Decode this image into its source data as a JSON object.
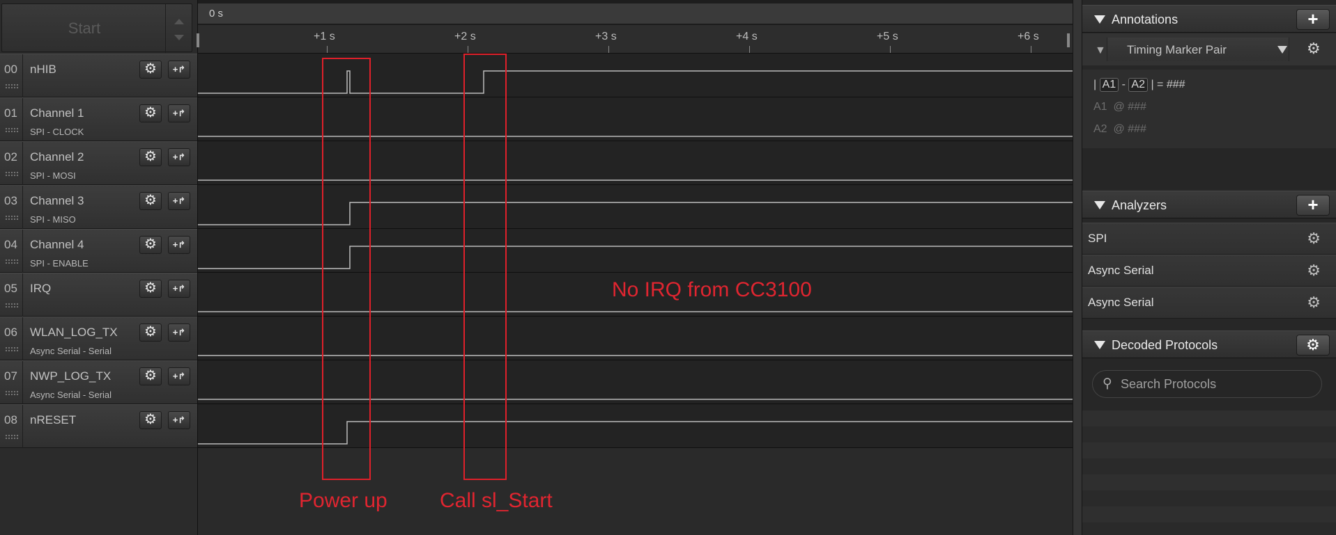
{
  "start_button": {
    "label": "Start"
  },
  "channels": [
    {
      "num": "00",
      "name": "nHIB",
      "sub": "",
      "color": "#2e2e2e"
    },
    {
      "num": "01",
      "name": "Channel 1",
      "sub": "SPI - CLOCK",
      "color": "#8a4a1e"
    },
    {
      "num": "02",
      "name": "Channel 2",
      "sub": "SPI - MOSI",
      "color": "#c0191b"
    },
    {
      "num": "03",
      "name": "Channel 3",
      "sub": "SPI - MISO",
      "color": "#e07a12"
    },
    {
      "num": "04",
      "name": "Channel 4",
      "sub": "SPI - ENABLE",
      "color": "#e8c20e"
    },
    {
      "num": "05",
      "name": "IRQ",
      "sub": "",
      "color": "#4fa228"
    },
    {
      "num": "06",
      "name": "WLAN_LOG_TX",
      "sub": "Async Serial - Serial",
      "color": "#3a4fb8"
    },
    {
      "num": "07",
      "name": "NWP_LOG_TX",
      "sub": "Async Serial - Serial",
      "color": "#8b2fb0"
    },
    {
      "num": "08",
      "name": "nRESET",
      "sub": "",
      "color": "#8a8a8a"
    }
  ],
  "timeline": {
    "origin_label": "0 s",
    "ticks": [
      "+1 s",
      "+2 s",
      "+3 s",
      "+4 s",
      "+5 s",
      "+6 s"
    ]
  },
  "annotations_overlay": {
    "power_up": "Power up",
    "call_start": "Call sl_Start",
    "no_irq": "No IRQ from CC3100",
    "color": "#e0202a"
  },
  "panels": {
    "annotations": {
      "title": "Annotations",
      "add_icon": "plus-icon",
      "marker_type": "Timing Marker Pair",
      "delta_a1": "A1",
      "delta_sep": "-",
      "delta_a2": "A2",
      "delta_eq": "= ###",
      "a1_label": "A1",
      "a1_value": "@ ###",
      "a2_label": "A2",
      "a2_value": "@ ###"
    },
    "analyzers": {
      "title": "Analyzers",
      "items": [
        "SPI",
        "Async Serial",
        "Async Serial"
      ]
    },
    "decoded_protocols": {
      "title": "Decoded Protocols",
      "search_placeholder": "Search Protocols"
    }
  }
}
